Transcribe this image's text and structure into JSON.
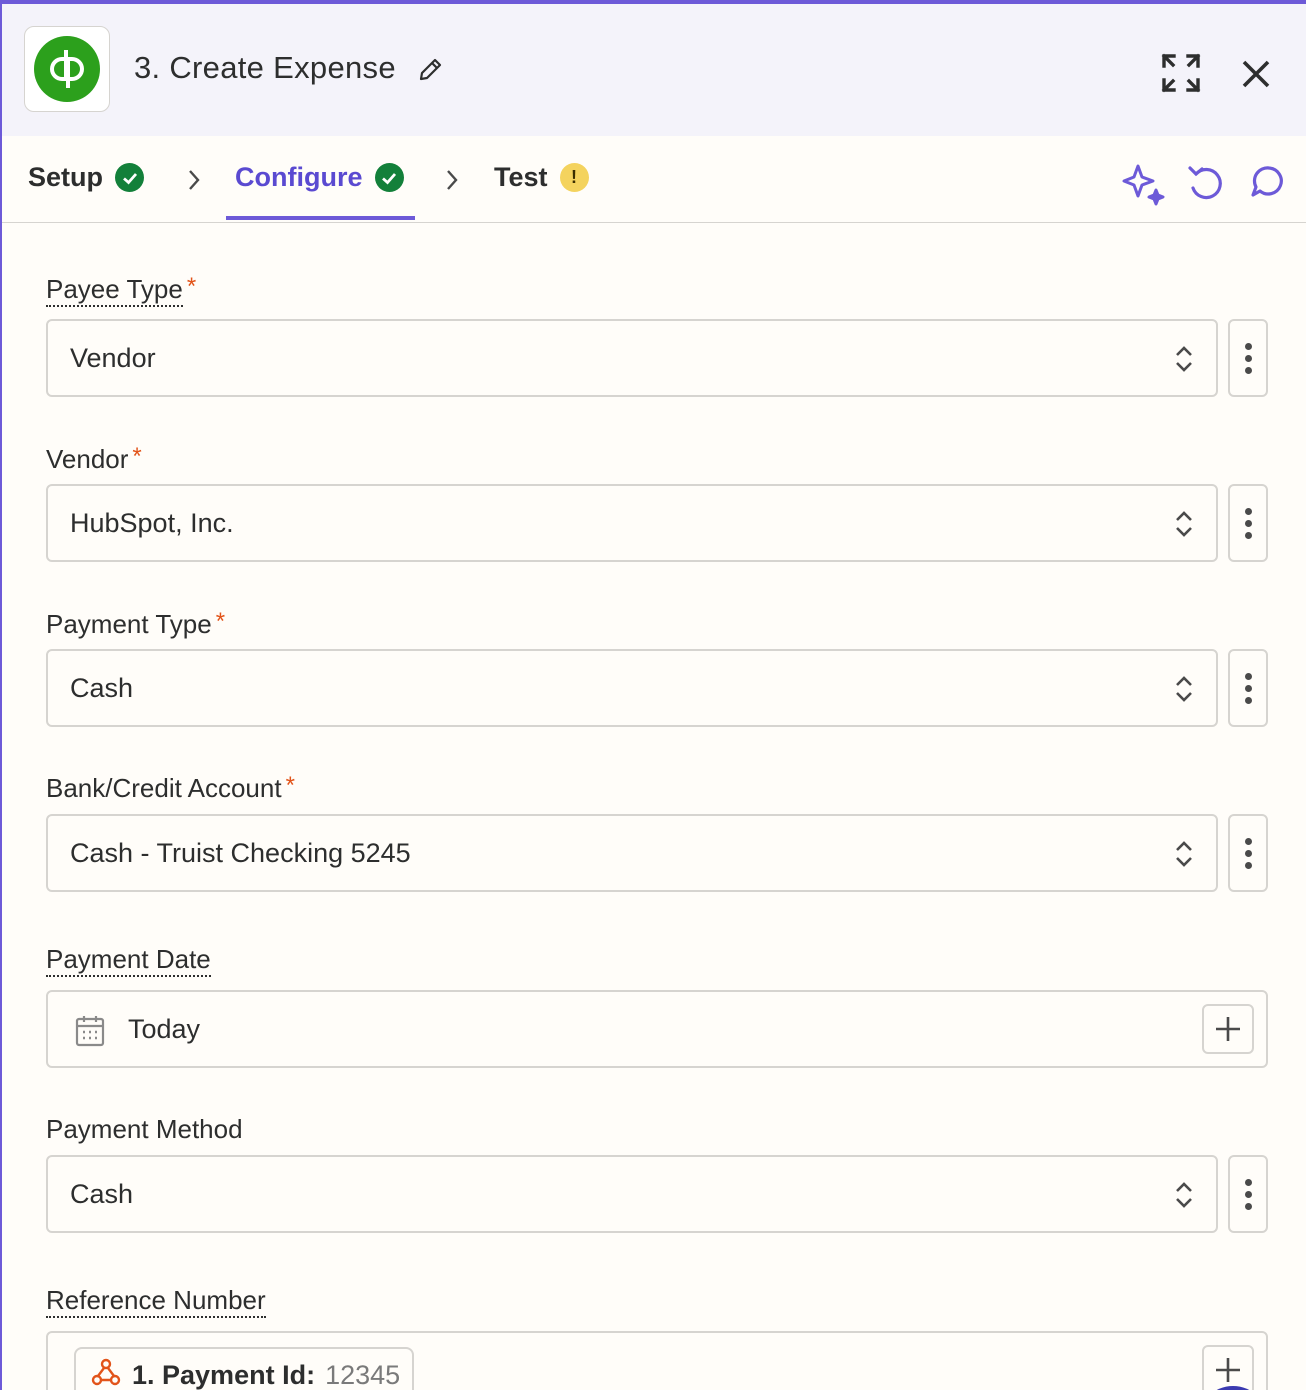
{
  "header": {
    "app_name": "QuickBooks Online",
    "title": "3. Create Expense"
  },
  "tabs": [
    {
      "label": "Setup",
      "status": "complete"
    },
    {
      "label": "Configure",
      "status": "complete",
      "active": true
    },
    {
      "label": "Test",
      "status": "warning",
      "badge_text": "!"
    }
  ],
  "toolbar": [
    "ai-sparkle-icon",
    "undo-icon",
    "comment-icon"
  ],
  "fields": {
    "payee_type": {
      "label": "Payee Type",
      "required_mark": "*",
      "value": "Vendor"
    },
    "vendor": {
      "label": "Vendor",
      "required_mark": "*",
      "value": "HubSpot, Inc."
    },
    "payment_type": {
      "label": "Payment Type",
      "required_mark": "*",
      "value": "Cash"
    },
    "bank_account": {
      "label": "Bank/Credit Account",
      "required_mark": "*",
      "value": "Cash - Truist Checking 5245"
    },
    "payment_date": {
      "label": "Payment Date",
      "value": "Today"
    },
    "payment_method": {
      "label": "Payment Method",
      "value": "Cash"
    },
    "reference_number": {
      "label": "Reference Number",
      "pill": {
        "name": "1. Payment Id:",
        "value": "12345"
      }
    }
  },
  "colors": {
    "accent": "#6d5ad8",
    "success": "#13803a",
    "warning": "#f4d35e",
    "required": "#e2541a",
    "quickbooks_green": "#2ca01c"
  }
}
